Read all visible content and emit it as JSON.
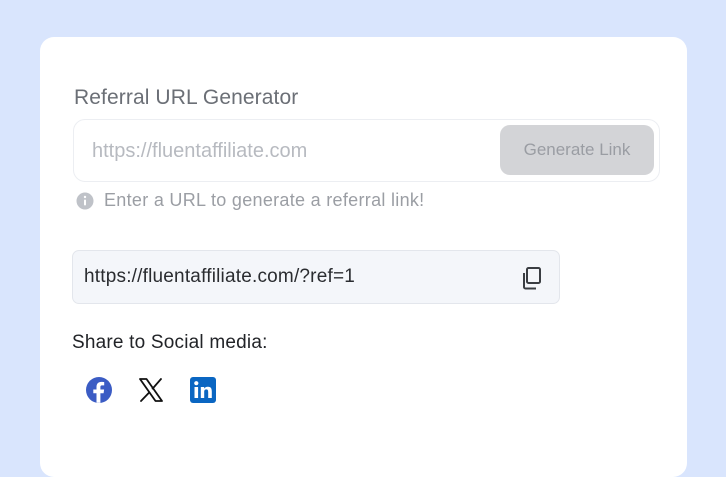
{
  "generator": {
    "title": "Referral URL Generator",
    "input_placeholder": "https://fluentaffiliate.com",
    "input_value": "",
    "button_label": "Generate Link",
    "hint": "Enter a URL to generate a referral link!"
  },
  "result": {
    "url": "https://fluentaffiliate.com/?ref=1",
    "copy_icon": "copy-icon"
  },
  "share": {
    "label": "Share to Social media:",
    "icons": [
      "facebook-icon",
      "x-icon",
      "linkedin-icon"
    ]
  },
  "colors": {
    "background": "#d9e5fd",
    "facebook": "#3b5cc4",
    "linkedin": "#0a66c2",
    "button_disabled": "#d3d4d7"
  }
}
